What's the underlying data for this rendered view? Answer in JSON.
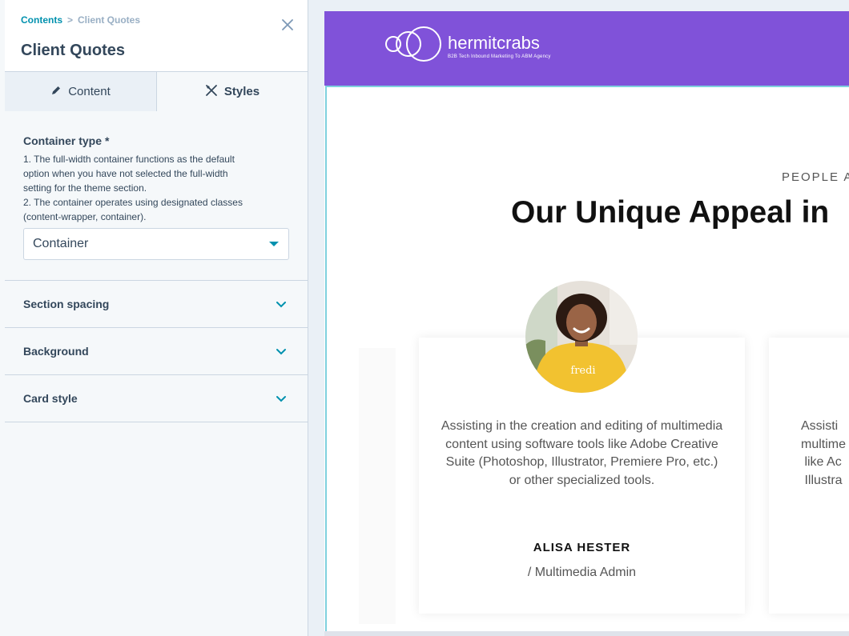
{
  "panel": {
    "breadcrumb": {
      "parent": "Contents",
      "separator": ">",
      "current": "Client Quotes"
    },
    "title": "Client Quotes",
    "tabs": [
      {
        "label": "Content",
        "icon": "pencil-icon"
      },
      {
        "label": "Styles",
        "icon": "styles-icon"
      }
    ],
    "container_type": {
      "label": "Container type",
      "required_mark": "*",
      "help_lines": [
        "1. The full-width container functions as the default",
        "option when you have not selected the full-width",
        "setting for the theme section.",
        "2. The container operates using designated classes",
        "(content-wrapper, container)."
      ],
      "value": "Container"
    },
    "accordions": [
      {
        "label": "Section spacing"
      },
      {
        "label": "Background"
      },
      {
        "label": "Card style"
      }
    ]
  },
  "preview": {
    "brand": {
      "name": "hermitcrabs",
      "tagline": "B2B Tech Inbound Marketing To ABM Agency"
    },
    "eyebrow": "PEOPLE A",
    "headline": "Our Unique Appeal in",
    "card": {
      "quote": "Assisting in the creation and editing of multimedia content using software tools like Adobe Creative Suite (Photoshop, Illustrator, Premiere Pro, etc.) or other specialized tools.",
      "name": "ALISA HESTER",
      "role": "/ Multimedia Admin",
      "sweater_text": "fredi"
    },
    "next_card_lines": "Assisti\nmultime\n like Ac\n Illustra"
  },
  "colors": {
    "accent": "#0091ae",
    "brand_purple": "#8052d9",
    "text": "#33475b",
    "sweater": "#f2c230"
  }
}
